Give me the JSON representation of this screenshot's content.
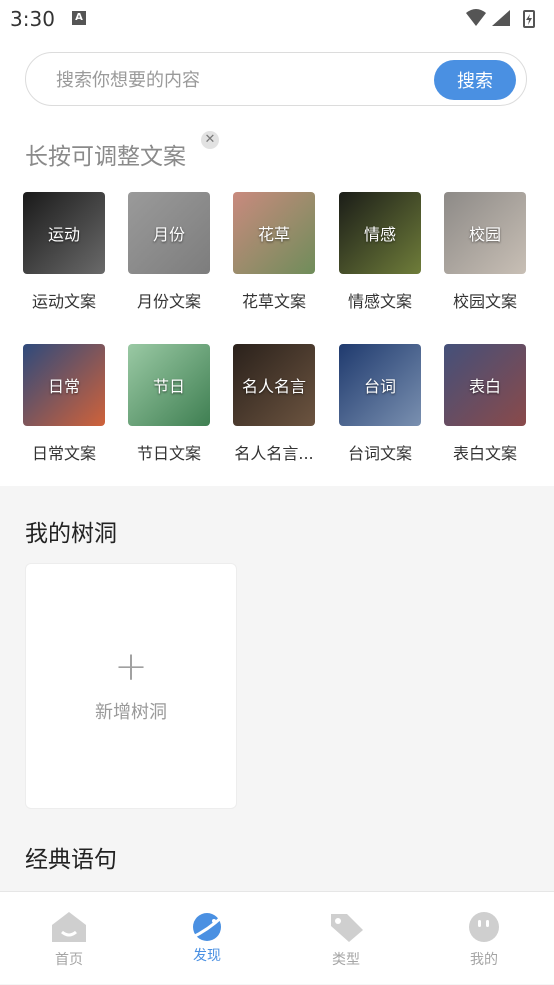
{
  "status": {
    "time": "3:30",
    "badge": "A"
  },
  "search": {
    "placeholder": "搜索你想要的内容",
    "button": "搜索"
  },
  "hint": {
    "text": "长按可调整文案",
    "close": "✕"
  },
  "categories": [
    {
      "overlay": "运动",
      "label": "运动文案",
      "color1": "#1a1a1a",
      "color2": "#6a6a6a"
    },
    {
      "overlay": "月份",
      "label": "月份文案",
      "color1": "#9a9a9a",
      "color2": "#7d7d7d"
    },
    {
      "overlay": "花草",
      "label": "花草文案",
      "color1": "#c98a7e",
      "color2": "#6f8d5a"
    },
    {
      "overlay": "情感",
      "label": "情感文案",
      "color1": "#1b1d18",
      "color2": "#6f7d3a"
    },
    {
      "overlay": "校园",
      "label": "校园文案",
      "color1": "#8d8a87",
      "color2": "#c8bfb5"
    },
    {
      "overlay": "日常",
      "label": "日常文案",
      "color1": "#2e4a7c",
      "color2": "#d0623a"
    },
    {
      "overlay": "节日",
      "label": "节日文案",
      "color1": "#9ac9a4",
      "color2": "#3f7f52"
    },
    {
      "overlay": "名人名言",
      "label": "名人名言...",
      "color1": "#2a211b",
      "color2": "#6c5440"
    },
    {
      "overlay": "台词",
      "label": "台词文案",
      "color1": "#1f3a6e",
      "color2": "#7a90b0"
    },
    {
      "overlay": "表白",
      "label": "表白文案",
      "color1": "#44507a",
      "color2": "#8a4a4a"
    }
  ],
  "treehole": {
    "title": "我的树洞",
    "add_plus": "+",
    "add_label": "新增树洞"
  },
  "classic": {
    "title": "经典语句"
  },
  "tabs": [
    {
      "label": "首页",
      "icon": "home-icon"
    },
    {
      "label": "发现",
      "icon": "planet-icon"
    },
    {
      "label": "类型",
      "icon": "tag-icon"
    },
    {
      "label": "我的",
      "icon": "face-icon"
    }
  ],
  "colors": {
    "accent": "#4a90e2",
    "inactive": "#cfcfcf"
  }
}
